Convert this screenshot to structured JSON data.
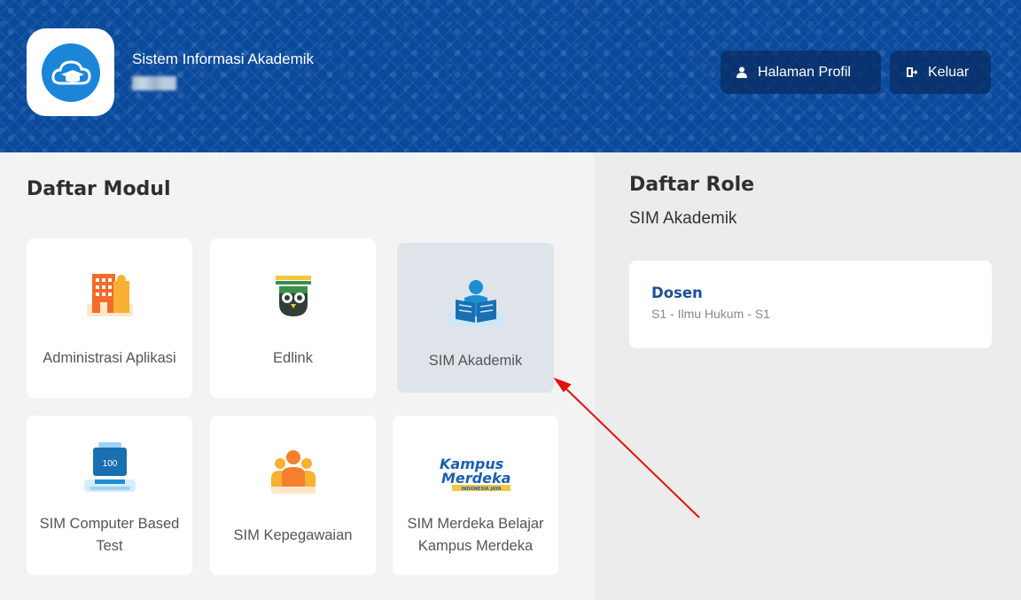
{
  "header": {
    "app_title": "Sistem Informasi Akademik",
    "profile_label": "Halaman Profil",
    "logout_label": "Keluar",
    "accent_color": "#0a4a9c"
  },
  "modules": {
    "title": "Daftar Modul",
    "items": [
      {
        "label": "Administrasi Aplikasi",
        "icon": "building-icon"
      },
      {
        "label": "Edlink",
        "icon": "owl-icon"
      },
      {
        "label": "SIM Akademik",
        "icon": "reading-student-icon",
        "selected": true
      },
      {
        "label": "SIM Computer Based Test",
        "icon": "computer-test-icon"
      },
      {
        "label": "SIM Kepegawaian",
        "icon": "people-group-icon"
      },
      {
        "label": "SIM Merdeka Belajar Kampus Merdeka",
        "icon": "kampus-merdeka-logo"
      }
    ]
  },
  "roles": {
    "title": "Daftar Role",
    "subtitle": "SIM Akademik",
    "items": [
      {
        "name": "Dosen",
        "detail": "S1 - Ilmu Hukum - S1"
      }
    ]
  },
  "icon_text": {
    "cbt_screen": "100",
    "kampus_line1": "Kampus",
    "kampus_line2": "Merdeka",
    "kampus_ribbon": "INDONESIA JAYA"
  },
  "colors": {
    "role_name": "#1b4f96",
    "arrow": "#e01010"
  }
}
